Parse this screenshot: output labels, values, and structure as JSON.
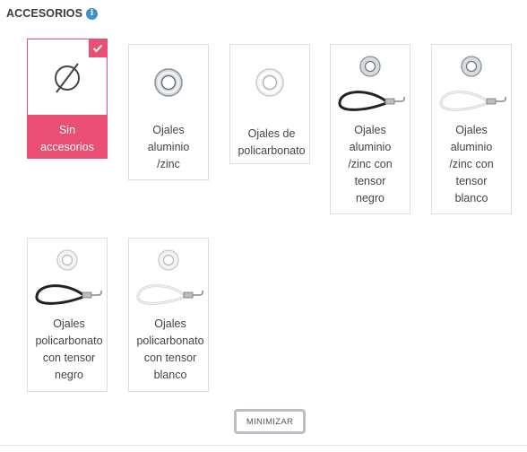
{
  "header": {
    "title": "ACCESORIOS",
    "info_icon": "info-icon"
  },
  "options": [
    {
      "label": "Sin accesorios",
      "selected": true,
      "icon": "empty-set-icon"
    },
    {
      "label": "Ojales aluminio /zinc",
      "selected": false,
      "icon": "grommet-metal-icon"
    },
    {
      "label": "Ojales de policarbonato",
      "selected": false,
      "icon": "grommet-clear-icon"
    },
    {
      "label": "Ojales aluminio /zinc con tensor negro",
      "selected": false,
      "icon": "grommet-metal-black-tensor-icon"
    },
    {
      "label": "Ojales aluminio /zinc con tensor blanco",
      "selected": false,
      "icon": "grommet-metal-white-tensor-icon"
    },
    {
      "label": "Ojales policarbonato con tensor negro",
      "selected": false,
      "icon": "grommet-clear-black-tensor-icon"
    },
    {
      "label": "Ojales policarbonato con tensor blanco",
      "selected": false,
      "icon": "grommet-clear-white-tensor-icon"
    }
  ],
  "minimize_button": {
    "label": "MINIMIZAR"
  },
  "colors": {
    "accent": "#ea4f73",
    "info": "#3d8fd1",
    "border": "#dcdcdc"
  }
}
